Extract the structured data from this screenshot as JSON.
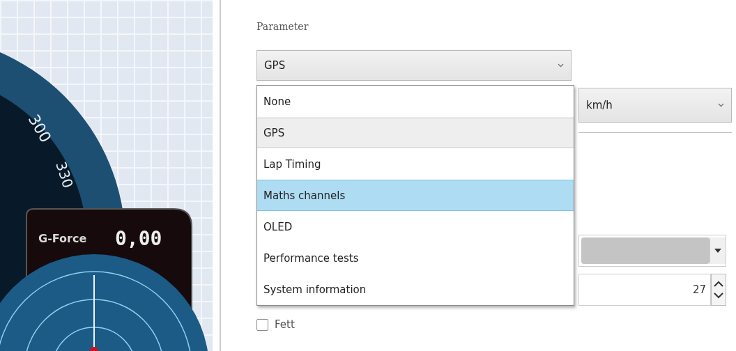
{
  "gauge": {
    "tick_labels": [
      "300",
      "330"
    ],
    "gforce_label": "G-Force",
    "gforce_value": "0,00"
  },
  "parameter": {
    "label": "Parameter",
    "value": "GPS",
    "options": [
      {
        "label": "None",
        "selected": false,
        "highlighted": false
      },
      {
        "label": "GPS",
        "selected": true,
        "highlighted": false
      },
      {
        "label": "Lap Timing",
        "selected": false,
        "highlighted": false
      },
      {
        "label": "Maths channels",
        "selected": false,
        "highlighted": true
      },
      {
        "label": "OLED",
        "selected": false,
        "highlighted": false
      },
      {
        "label": "Performance tests",
        "selected": false,
        "highlighted": false
      },
      {
        "label": "System information",
        "selected": false,
        "highlighted": false
      }
    ]
  },
  "unit": {
    "value": "km/h"
  },
  "color_select": {
    "disabled": true
  },
  "size_field": {
    "value": "27"
  },
  "bold_checkbox": {
    "label": "Fett",
    "checked": false
  }
}
